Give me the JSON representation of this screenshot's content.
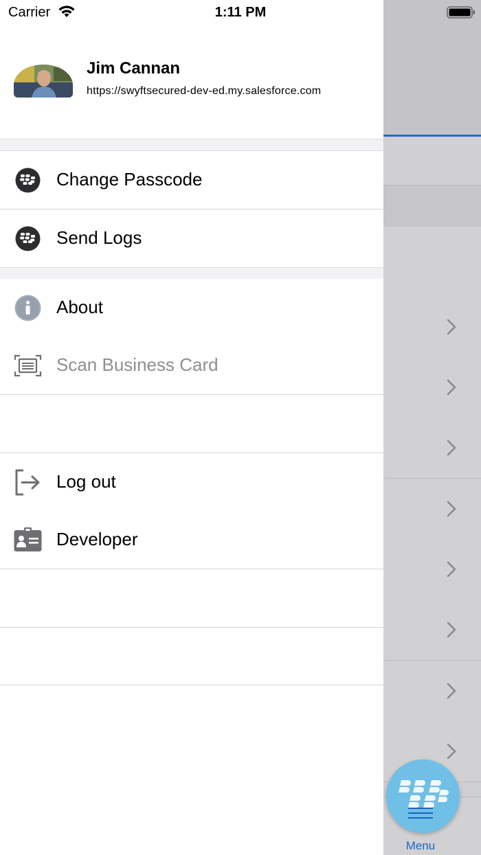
{
  "status_bar": {
    "carrier": "Carrier",
    "time": "1:11 PM"
  },
  "profile": {
    "name": "Jim Cannan",
    "url": "https://swyftsecured-dev-ed.my.salesforce.com"
  },
  "menu": {
    "change_passcode": "Change Passcode",
    "send_logs": "Send Logs",
    "about": "About",
    "scan_business_card": "Scan Business Card",
    "log_out": "Log out",
    "developer": "Developer"
  },
  "fab": {
    "label": "Menu"
  },
  "colors": {
    "accent": "#1b6ed1",
    "fab": "#6fbfe6",
    "disabled_text": "#8e8e93"
  },
  "icons": {
    "change_passcode": "blackberry-icon",
    "send_logs": "blackberry-icon",
    "about": "info-icon",
    "scan_business_card": "scan-card-icon",
    "log_out": "logout-icon",
    "developer": "id-card-icon"
  }
}
